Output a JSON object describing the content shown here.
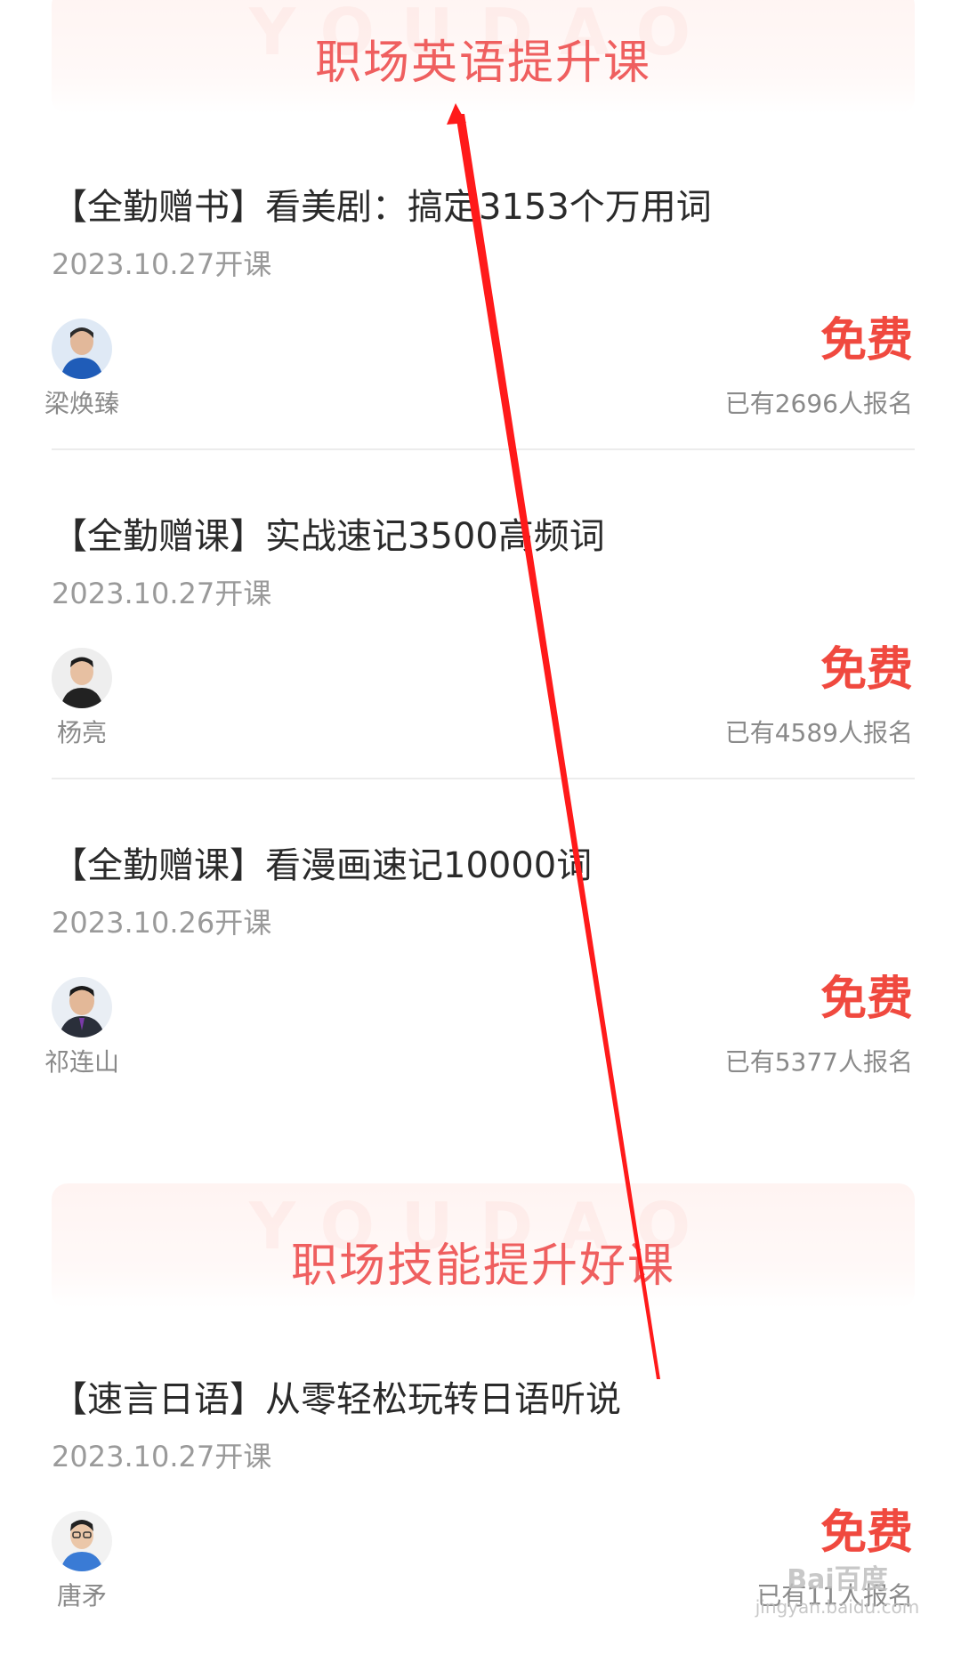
{
  "sections": [
    {
      "title": "职场英语提升课",
      "watermark": "YOUDAO"
    },
    {
      "title": "职场技能提升好课",
      "watermark": "YOUDAO"
    }
  ],
  "courses": [
    {
      "title": "【全勤赠书】看美剧：搞定3153个万用词",
      "date": "2023.10.27开课",
      "teacher": "梁焕臻",
      "price": "免费",
      "enrolled": "已有2696人报名"
    },
    {
      "title": "【全勤赠课】实战速记3500高频词",
      "date": "2023.10.27开课",
      "teacher": "杨亮",
      "price": "免费",
      "enrolled": "已有4589人报名"
    },
    {
      "title": "【全勤赠课】看漫画速记10000词",
      "date": "2023.10.26开课",
      "teacher": "祁连山",
      "price": "免费",
      "enrolled": "已有5377人报名"
    },
    {
      "title": "【速言日语】从零轻松玩转日语听说",
      "date": "2023.10.27开课",
      "teacher": "唐矛",
      "price": "免费",
      "enrolled": "已有11人报名"
    }
  ],
  "colors": {
    "accent": "#f0493f",
    "header_title": "#ef5f5f",
    "annotation_arrow": "#ff1a1a"
  },
  "watermark": {
    "logo": "Bai百度",
    "url": "jingyan.baidu.com"
  }
}
